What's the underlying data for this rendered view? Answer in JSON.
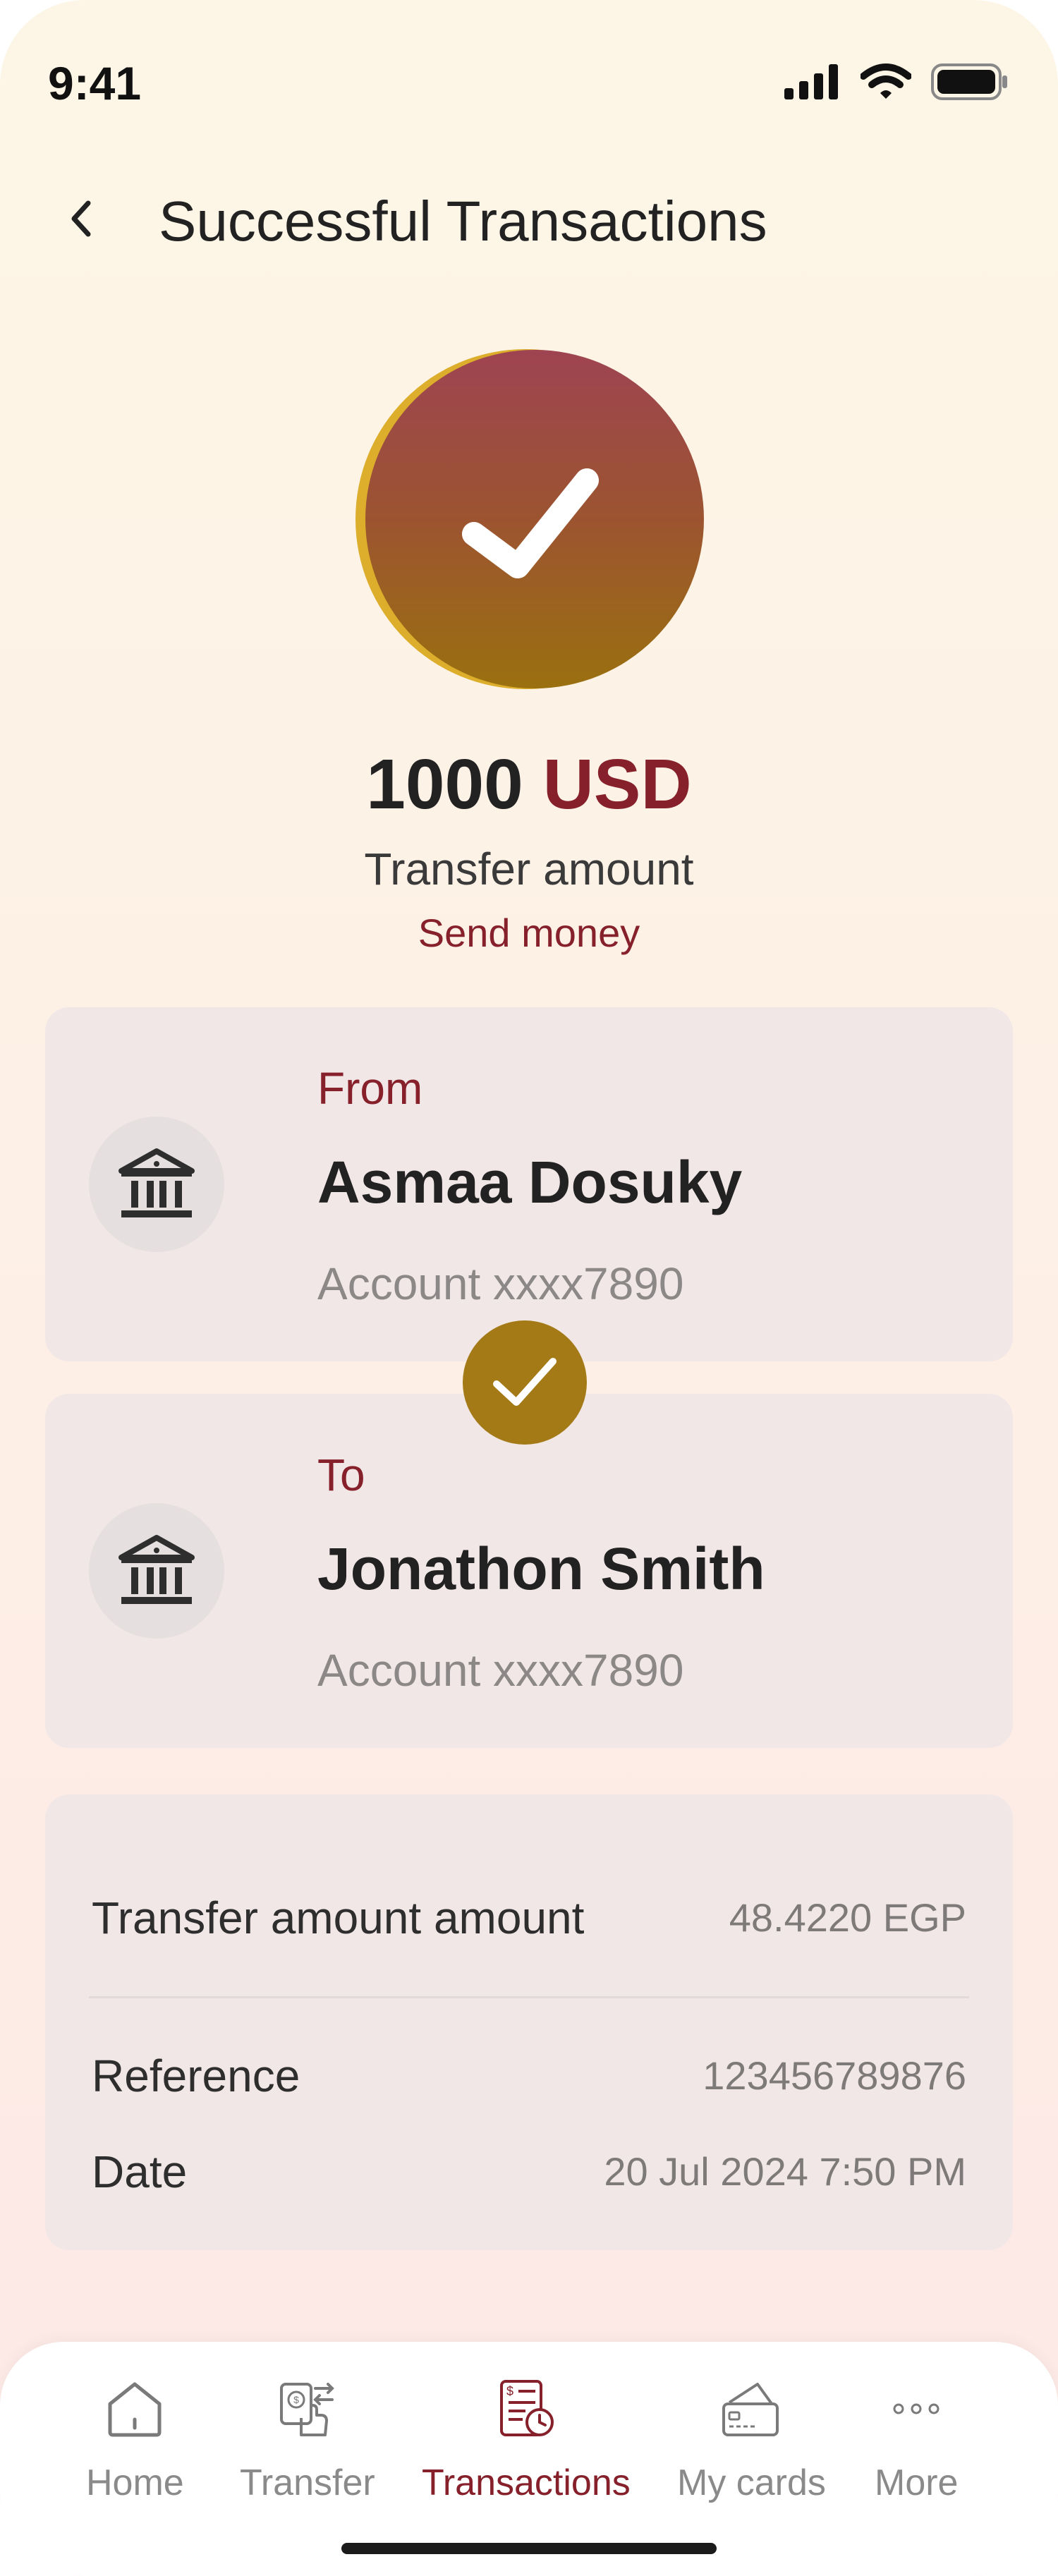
{
  "status_bar": {
    "time": "9:41"
  },
  "header": {
    "title": "Successful Transactions"
  },
  "summary": {
    "amount": "1000",
    "currency": "USD",
    "label": "Transfer amount",
    "action_link": "Send money"
  },
  "from": {
    "label": "From",
    "name": "Asmaa Dosuky",
    "account": "Account xxxx7890"
  },
  "to": {
    "label": "To",
    "name": "Jonathon Smith",
    "account": "Account xxxx7890"
  },
  "details": [
    {
      "label": "Transfer amount amount",
      "value": "48.4220 EGP"
    },
    {
      "label": "Reference",
      "value": "123456789876"
    },
    {
      "label": "Date",
      "value": "20 Jul 2024 7:50 PM"
    }
  ],
  "tabs": [
    {
      "label": "Home",
      "icon": "home-icon",
      "active": false
    },
    {
      "label": "Transfer",
      "icon": "transfer-icon",
      "active": false
    },
    {
      "label": "Transactions",
      "icon": "transactions-icon",
      "active": true
    },
    {
      "label": "My cards",
      "icon": "card-icon",
      "active": false
    },
    {
      "label": "More",
      "icon": "more-icon",
      "active": false
    }
  ],
  "colors": {
    "accent": "#86202b",
    "gold": "#a47a17",
    "card_bg": "#f2e7e7",
    "background": "#fdf4e8"
  }
}
